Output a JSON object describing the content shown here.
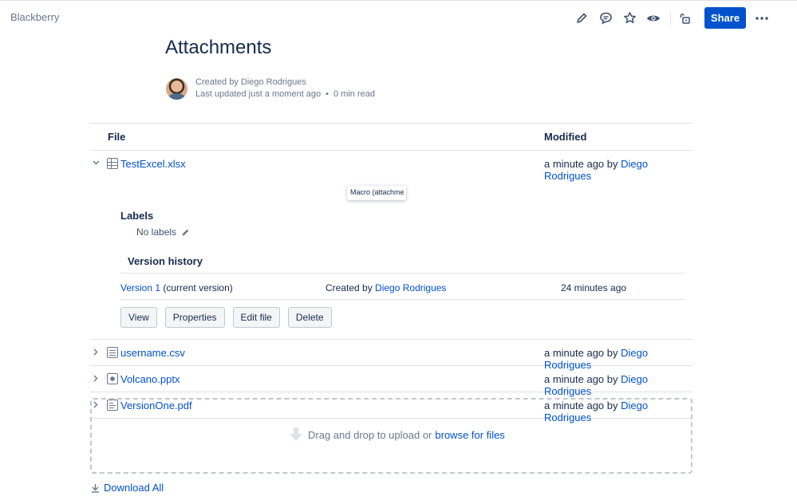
{
  "header": {
    "space_name": "Blackberry",
    "share_label": "Share",
    "icons": [
      "edit-icon",
      "comment-icon",
      "star-icon",
      "watch-icon",
      "restrictions-icon",
      "more-icon"
    ]
  },
  "page": {
    "title": "Attachments",
    "byline": {
      "created_by": "Created by Diego Rodrigues",
      "last_updated": "Last updated just a moment ago",
      "read_time": "0 min read"
    }
  },
  "table": {
    "columns": [
      "File",
      "Modified"
    ],
    "rows": [
      {
        "name": "TestExcel.xlsx",
        "icon": "spreadsheet-icon",
        "modified_prefix": "a minute ago by",
        "modified_user": "Diego Rodrigues",
        "expanded": true
      },
      {
        "name": "username.csv",
        "icon": "text-file-icon",
        "modified_prefix": "a minute ago by",
        "modified_user": "Diego Rodrigues"
      },
      {
        "name": "Volcano.pptx",
        "icon": "presentation-icon",
        "modified_prefix": "a minute ago by",
        "modified_user": "Diego Rodrigues"
      },
      {
        "name": "VersionOne.pdf",
        "icon": "pdf-icon",
        "modified_prefix": "a minute ago by",
        "modified_user": "Diego Rodrigues"
      }
    ],
    "expanded_details": {
      "tooltip": "Macro (attachme",
      "labels_heading": "Labels",
      "no_labels": "No labels",
      "version_history_heading": "Version history",
      "version_link": "Version 1",
      "version_suffix": "(current version)",
      "created_by_prefix": "Created by",
      "created_by_user": "Diego Rodrigues",
      "version_time": "24 minutes ago",
      "buttons": [
        "View",
        "Properties",
        "Edit file",
        "Delete"
      ]
    }
  },
  "upload": {
    "text": "Drag and drop to upload or",
    "browse_link": "browse for files"
  },
  "download_all": "Download All",
  "colors": {
    "primary": "#0052cc",
    "text": "#172b4d",
    "subtle": "#6b778c",
    "border": "#dfe1e6"
  }
}
